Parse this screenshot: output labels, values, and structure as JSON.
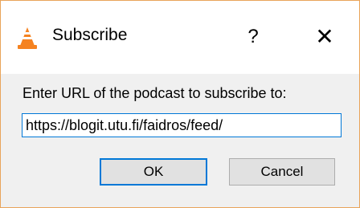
{
  "window": {
    "title": "Subscribe",
    "app_icon": "vlc-cone-icon",
    "help_label": "?",
    "close_label": "✕"
  },
  "dialog": {
    "prompt": "Enter URL of the podcast to subscribe to:",
    "url_value": "https://blogit.utu.fi/faidros/feed/",
    "ok_label": "OK",
    "cancel_label": "Cancel"
  },
  "colors": {
    "accent": "#0078d7",
    "window_border": "#e9a45a",
    "cone_orange": "#f58220"
  }
}
